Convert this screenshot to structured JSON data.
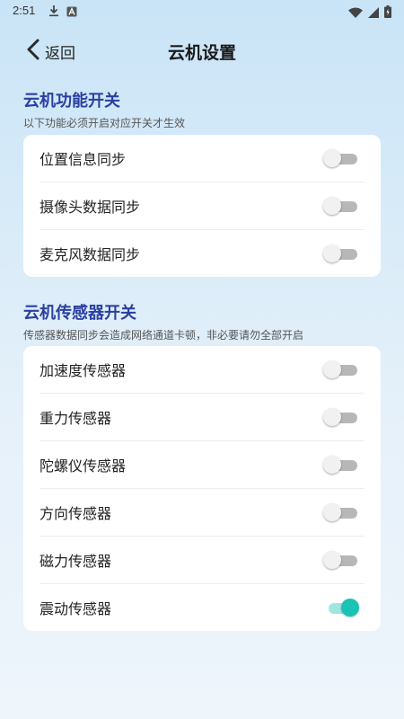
{
  "status_bar": {
    "time": "2:51",
    "icons": [
      "download-icon",
      "a-square-icon",
      "wifi-icon",
      "signal-icon",
      "battery-icon"
    ]
  },
  "header": {
    "back_label": "返回",
    "title": "云机设置"
  },
  "section1": {
    "title": "云机功能开关",
    "desc": "以下功能必须开启对应开关才生效",
    "items": [
      {
        "label": "位置信息同步",
        "on": false
      },
      {
        "label": "摄像头数据同步",
        "on": false
      },
      {
        "label": "麦克风数据同步",
        "on": false
      }
    ]
  },
  "section2": {
    "title": "云机传感器开关",
    "desc": "传感器数据同步会造成网络通道卡顿，非必要请勿全部开启",
    "items": [
      {
        "label": "加速度传感器",
        "on": false
      },
      {
        "label": "重力传感器",
        "on": false
      },
      {
        "label": "陀螺仪传感器",
        "on": false
      },
      {
        "label": "方向传感器",
        "on": false
      },
      {
        "label": "磁力传感器",
        "on": false
      },
      {
        "label": "震动传感器",
        "on": true
      }
    ]
  },
  "colors": {
    "section_title": "#2a3fa0",
    "toggle_on_thumb": "#19c3b6",
    "toggle_on_track": "#9fe6e0",
    "toggle_off_track": "#b7b7b7"
  }
}
